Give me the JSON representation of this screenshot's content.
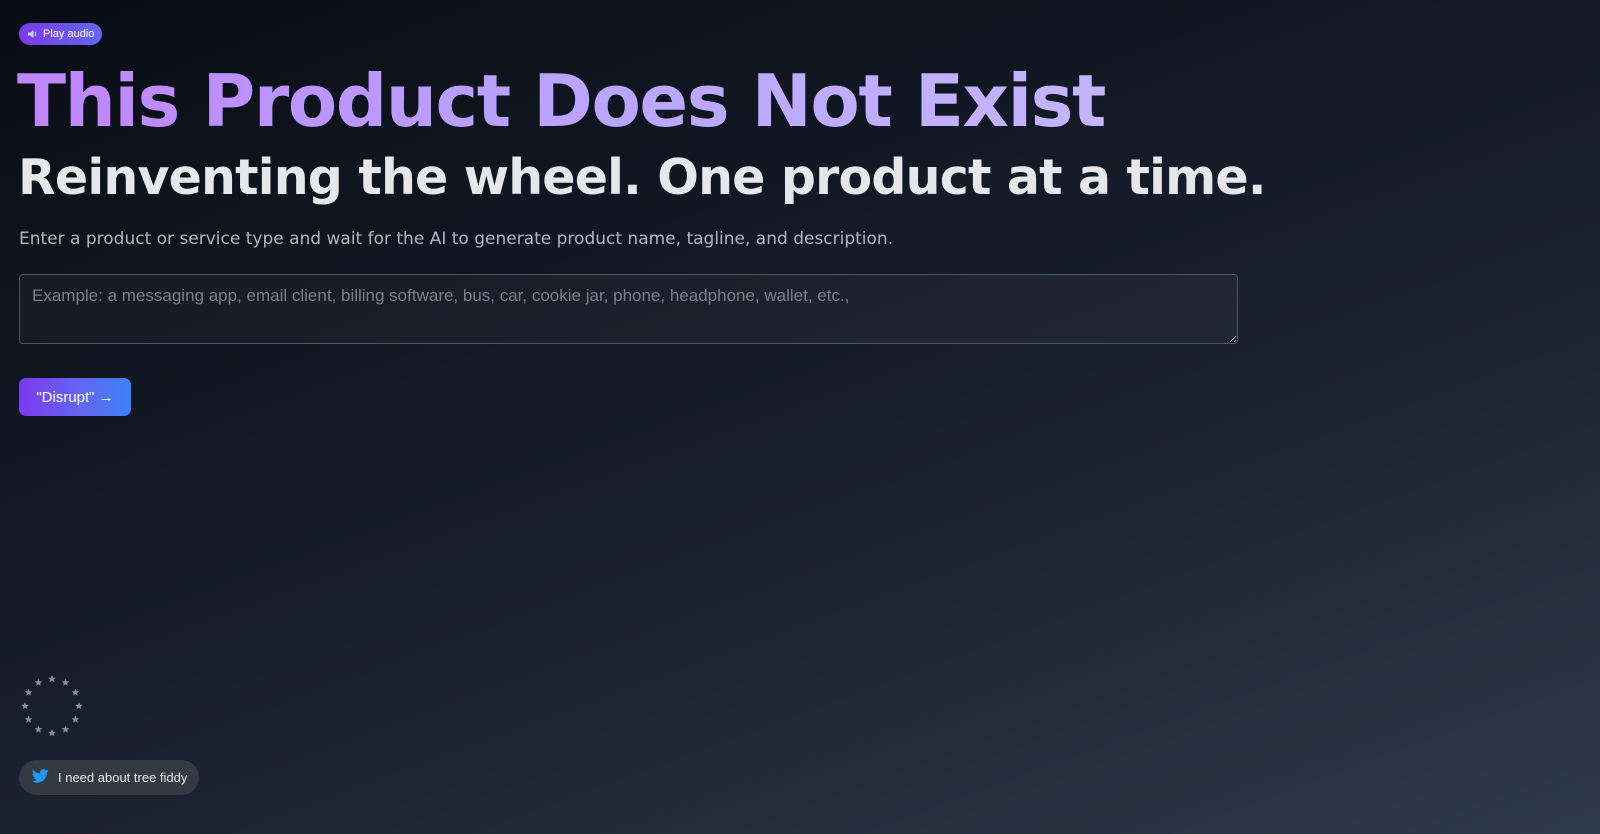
{
  "audio": {
    "label": "Play audio",
    "icon": "speaker-icon"
  },
  "hero": {
    "title": "This Product Does Not Exist",
    "subtitle": "Reinventing the wheel. One product at a time.",
    "description": "Enter a product or service type and wait for the AI to generate product name, tagline, and description."
  },
  "input": {
    "placeholder": "Example: a messaging app, email client, billing software, bus, car, cookie jar, phone, headphone, wallet, etc.,",
    "value": ""
  },
  "button": {
    "label": "\"Disrupt\" →"
  },
  "footer": {
    "badge_icon": "eu-stars-icon",
    "tweet_label": "I need about tree fiddy",
    "tweet_icon": "twitter-icon"
  },
  "colors": {
    "accent_purple": "#7c3aed",
    "accent_blue": "#3b82f6",
    "title_gradient_start": "#c084fc",
    "title_gradient_end": "#c4b5fd",
    "twitter_blue": "#1d9bf0"
  }
}
